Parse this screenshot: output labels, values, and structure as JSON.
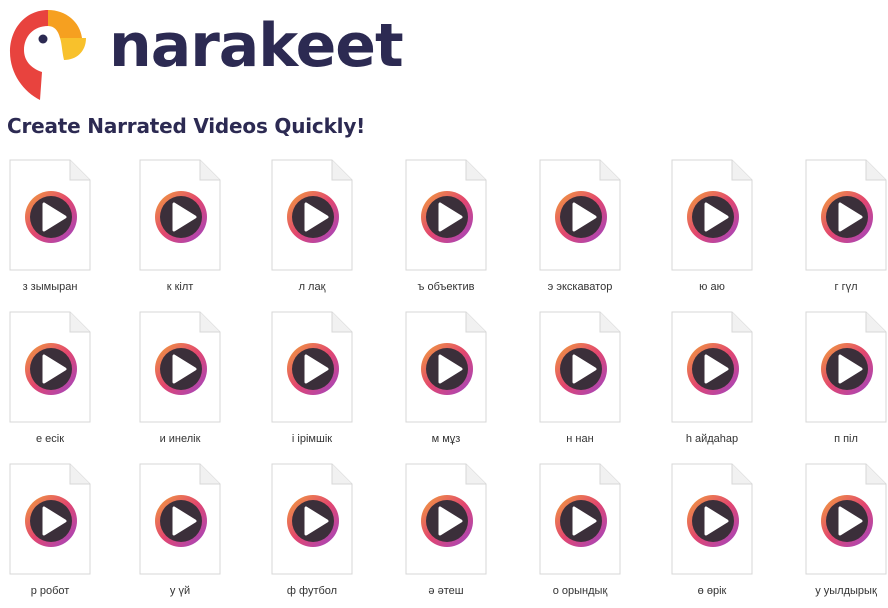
{
  "brand": {
    "name": "narakeet",
    "tagline": "Create Narrated Videos Quickly!"
  },
  "files": [
    {
      "label": "з зымыран"
    },
    {
      "label": "к кілт"
    },
    {
      "label": "л лақ"
    },
    {
      "label": "ъ объектив"
    },
    {
      "label": "э экскаватор"
    },
    {
      "label": "ю аю"
    },
    {
      "label": "г гүл"
    },
    {
      "label": "е есік"
    },
    {
      "label": "и инелік"
    },
    {
      "label": "і ірімшік"
    },
    {
      "label": "м мұз"
    },
    {
      "label": "н нан"
    },
    {
      "label": "һ айдаһар"
    },
    {
      "label": "п піл"
    },
    {
      "label": "р робот"
    },
    {
      "label": "у үй"
    },
    {
      "label": "ф футбол"
    },
    {
      "label": "ә әтеш"
    },
    {
      "label": "о орындық"
    },
    {
      "label": "ө өрік"
    },
    {
      "label": "у уылдырық"
    }
  ],
  "icons": {
    "file": "document-icon",
    "media": "play-icon"
  },
  "colors": {
    "brand_text": "#2c2a52",
    "logo_red": "#e8433e",
    "logo_orange": "#f6a020",
    "logo_yellow": "#f8c12c",
    "ring_gradient": [
      "#f2a23a",
      "#e2466f",
      "#9c45c7"
    ],
    "play_disc": "#3b2f3a"
  }
}
